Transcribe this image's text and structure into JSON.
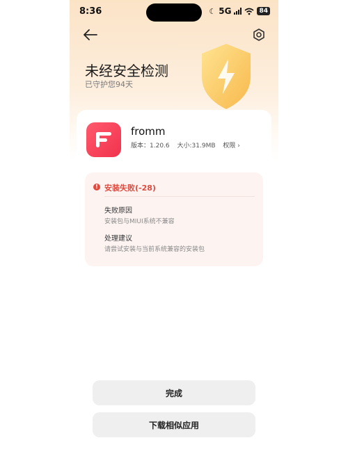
{
  "status_bar": {
    "time": "8:36",
    "network": "5G",
    "battery": "84"
  },
  "header": {
    "title": "未经安全检测",
    "subtitle": "已守护您94天"
  },
  "app": {
    "name": "fromm",
    "version": "版本：1.20.6",
    "size": "大小:31.9MB",
    "permissions": "权限",
    "icon_color": "#f1324d"
  },
  "error": {
    "title": "安装失败(-28)",
    "reason_label": "失败原因",
    "reason_text": "安装包与MIUI系统不兼容",
    "advice_label": "处理建议",
    "advice_text": "请尝试安装与当前系统兼容的安装包",
    "color": "#e14a3d"
  },
  "actions": {
    "done_label": "完成",
    "download_similar_label": "下载相似应用"
  }
}
